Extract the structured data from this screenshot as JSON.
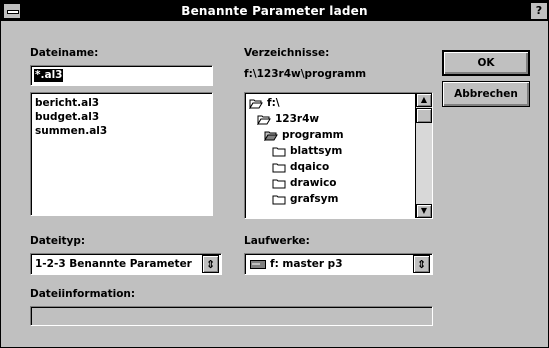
{
  "window": {
    "title": "Benannte Parameter laden",
    "close_glyph": "?"
  },
  "filename": {
    "label": "Dateiname:",
    "value": "*.al3",
    "files": [
      "bericht.al3",
      "budget.al3",
      "summen.al3"
    ]
  },
  "directories": {
    "label": "Verzeichnisse:",
    "path": "f:\\123r4w\\programm",
    "items": [
      "f:\\",
      "123r4w",
      "programm",
      "blattsym",
      "dqaico",
      "drawico",
      "grafsym"
    ]
  },
  "buttons": {
    "ok": "OK",
    "cancel": "Abbrechen"
  },
  "filetype": {
    "label": "Dateityp:",
    "value": "1-2-3 Benannte Parameter"
  },
  "drives": {
    "label": "Laufwerke:",
    "value": "f: master p3"
  },
  "fileinfo": {
    "label": "Dateiinformation:",
    "value": ""
  }
}
